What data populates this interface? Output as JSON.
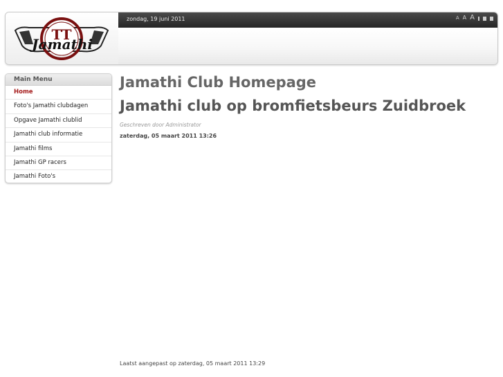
{
  "header": {
    "logo_text": "Jamathi",
    "logo_mark": "TT",
    "date": "zondag, 19 juni 2011",
    "font_controls": [
      {
        "name": "font-small-button",
        "label": "A",
        "size": "small"
      },
      {
        "name": "font-medium-button",
        "label": "A",
        "size": "mid"
      },
      {
        "name": "font-large-button",
        "label": "A",
        "size": "big"
      }
    ]
  },
  "menu": {
    "title": "Main Menu",
    "items": [
      {
        "label": "Home",
        "active": true
      },
      {
        "label": "Foto's Jamathi clubdagen",
        "active": false
      },
      {
        "label": "Opgave Jamathi clublid",
        "active": false
      },
      {
        "label": "Jamathi club informatie",
        "active": false
      },
      {
        "label": "Jamathi films",
        "active": false
      },
      {
        "label": "Jamathi GP racers",
        "active": false
      },
      {
        "label": "Jamathi Foto's",
        "active": false
      }
    ]
  },
  "content": {
    "page_title": "Jamathi Club Homepage",
    "article_title": "Jamathi club op bromfietsbeurs Zuidbroek",
    "author": "Geschreven door Administrator",
    "created": "zaterdag, 05 maart 2011 13:26",
    "modified": "Laatst aangepast op zaterdag, 05 maart 2011 13:29"
  },
  "colors": {
    "accent": "#a51c1c",
    "topbar": "#2e2e2e"
  }
}
